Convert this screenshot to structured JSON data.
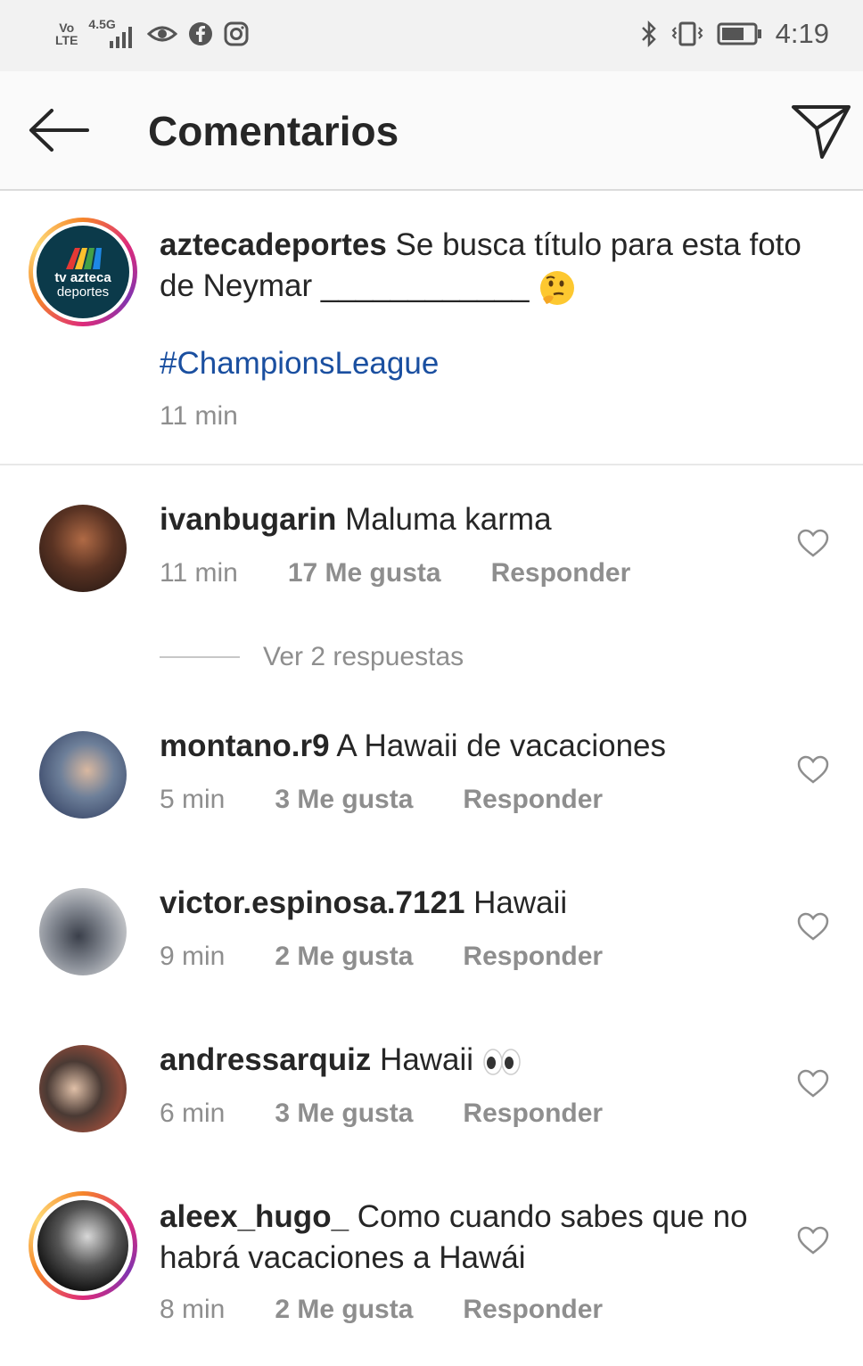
{
  "status_bar": {
    "carrier_top": "Vo",
    "carrier_bottom": "LTE",
    "network": "4.5G",
    "time": "4:19"
  },
  "header": {
    "title": "Comentarios"
  },
  "caption": {
    "username": "aztecadeportes",
    "text": " Se busca título para esta foto de Neymar ____________ ",
    "hashtag": "#ChampionsLeague",
    "time": "11 min",
    "avatar_logo_line1": "tv azteca",
    "avatar_logo_line2": "deportes"
  },
  "comments": [
    {
      "username": "ivanbugarin",
      "text": " Maluma karma",
      "time": "11 min",
      "likes": "17 Me gusta",
      "reply": "Responder"
    },
    {
      "username": "montano.r9",
      "text": " A Hawaii de vacaciones",
      "time": "5 min",
      "likes": "3 Me gusta",
      "reply": "Responder"
    },
    {
      "username": "victor.espinosa.7121",
      "text": " Hawaii",
      "time": "9 min",
      "likes": "2 Me gusta",
      "reply": "Responder"
    },
    {
      "username": "andressarquiz",
      "text": " Hawaii ",
      "time": "6 min",
      "likes": "3 Me gusta",
      "reply": "Responder"
    },
    {
      "username": "aleex_hugo_",
      "text": " Como cuando sabes que no habrá vacaciones a Hawái",
      "time": "8 min",
      "likes": "2 Me gusta",
      "reply": "Responder"
    }
  ],
  "view_replies": "Ver 2 respuestas",
  "icons": [
    "back-arrow-icon",
    "send-icon",
    "heart-icon",
    "thinking-face-emoji",
    "eyes-emoji"
  ],
  "colors": {
    "hashtag": "#1a4fa0",
    "secondary_text": "#8e8e8e",
    "header_bg": "#fafafa"
  }
}
